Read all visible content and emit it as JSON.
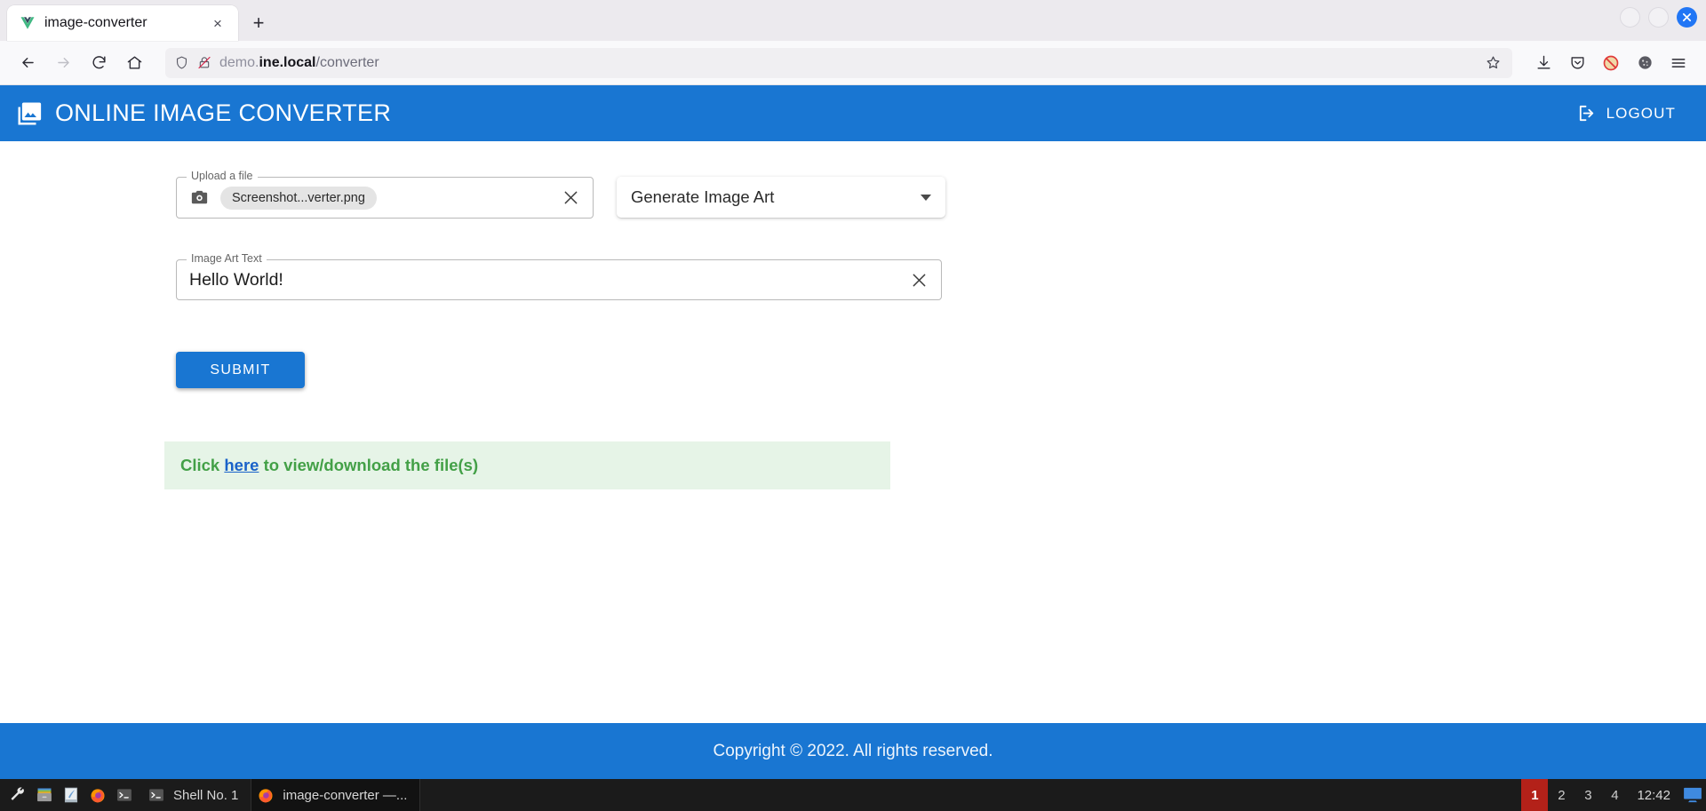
{
  "browser": {
    "tab": {
      "title": "image-converter",
      "favicon": "vue-logo-icon",
      "close_label": "×"
    },
    "newtab_label": "+",
    "window_controls": {
      "minimize": "minimize-button",
      "maximize": "maximize-button",
      "close_label": "×"
    },
    "nav": {
      "back": "back-button",
      "forward": "forward-button",
      "reload": "reload-button",
      "home": "home-button"
    },
    "url": {
      "prefix": "demo.",
      "domain": "ine.local",
      "path": "/converter",
      "shield": "shield-icon",
      "lock": "lock-crossed-icon",
      "bookmark": "star-icon"
    },
    "toolbar": {
      "downloads": "download-icon",
      "pocket": "pocket-icon",
      "blocked": "blocked-icon",
      "cookies": "cookie-icon",
      "menu": "hamburger-menu-icon"
    }
  },
  "app": {
    "header": {
      "logo": "photo-library-icon",
      "title": "ONLINE IMAGE CONVERTER",
      "logout_label": "LOGOUT",
      "logout_icon": "logout-icon",
      "accent": "#1976d2"
    },
    "form": {
      "upload": {
        "legend": "Upload a file",
        "camera_icon": "camera-icon",
        "file_chip": "Screenshot...verter.png",
        "clear_label": "✕"
      },
      "operation_select": {
        "value": "Generate Image Art",
        "caret_icon": "chevron-down-icon"
      },
      "art_text": {
        "legend": "Image Art Text",
        "value": "Hello World!",
        "placeholder": "Image Art Text",
        "clear_label": "✕"
      },
      "submit_label": "SUBMIT"
    },
    "alert": {
      "prefix": "Click ",
      "link_label": "here",
      "suffix": " to view/download the file(s)",
      "bg": "#e6f4e7",
      "text_color": "#43a047"
    },
    "footer": {
      "text": "Copyright © 2022. All rights reserved."
    }
  },
  "taskbar": {
    "launchers": [
      "wrench-icon",
      "file-manager-icon",
      "text-editor-icon",
      "firefox-icon",
      "terminal-icon"
    ],
    "windows": [
      {
        "icon": "terminal-icon",
        "label": "Shell No. 1"
      },
      {
        "icon": "firefox-icon",
        "label": "image-converter —..."
      }
    ],
    "workspaces": [
      "1",
      "2",
      "3",
      "4"
    ],
    "current_workspace": "1",
    "clock": "12:42",
    "tray": "display-icon"
  }
}
